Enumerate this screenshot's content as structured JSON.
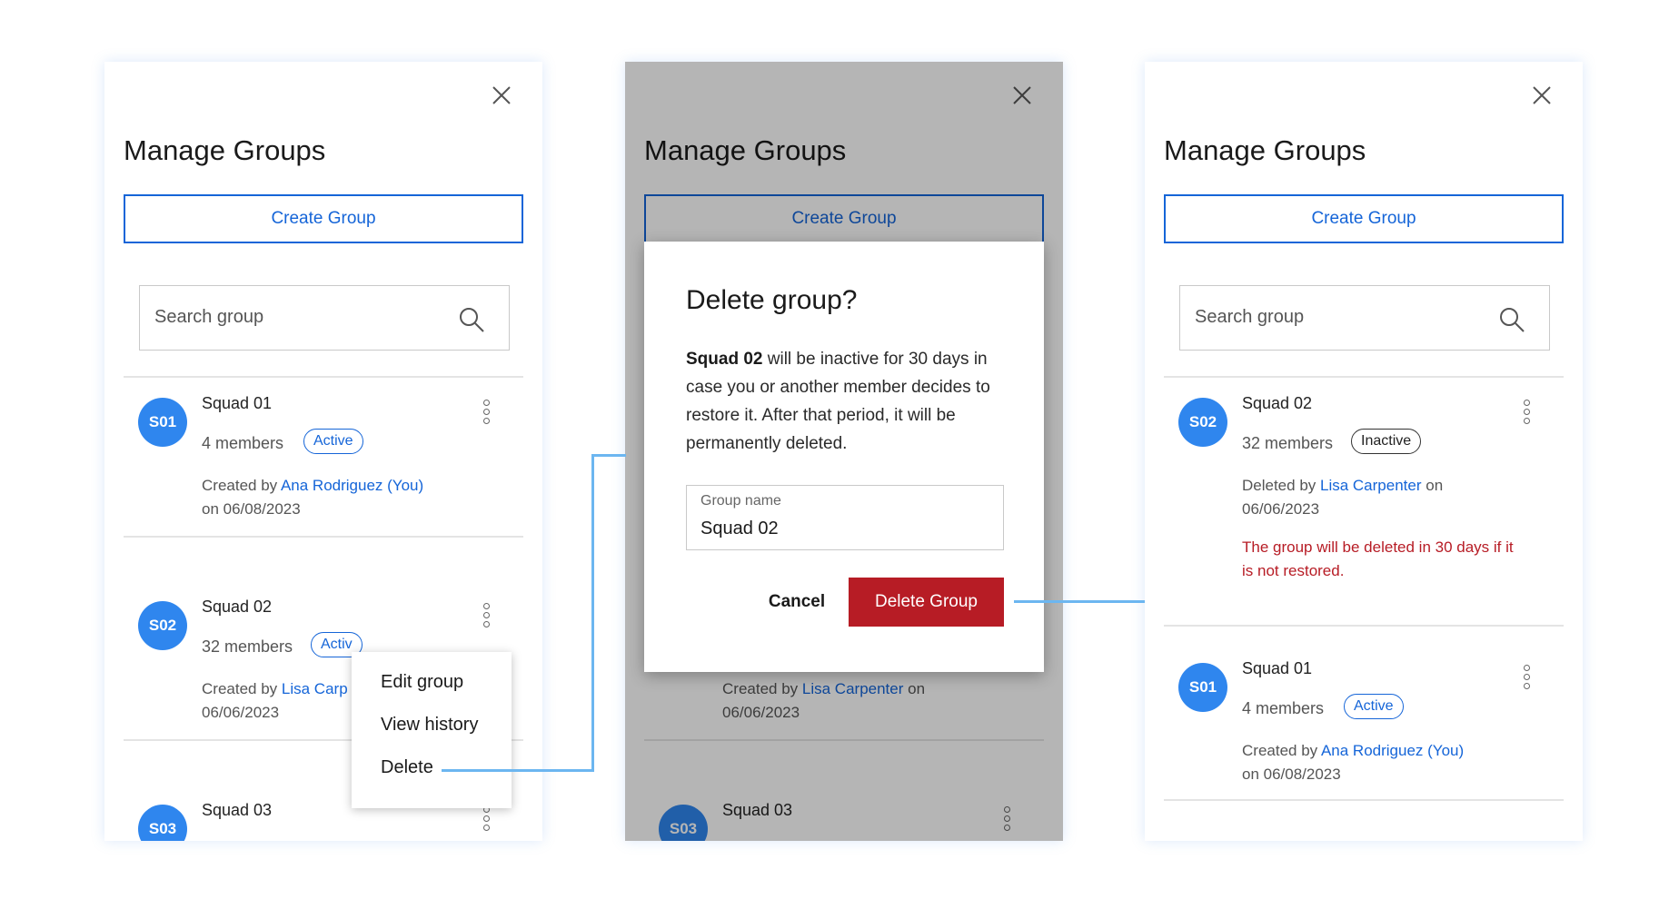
{
  "panel_left": {
    "title": "Manage Groups",
    "create_label": "Create Group",
    "search_placeholder": "Search group",
    "groups": [
      {
        "initials": "S01",
        "name": "Squad 01",
        "members": "4 members",
        "status": "Active",
        "meta_prefix": "Created by ",
        "meta_user": "Ana Rodriguez (You)",
        "meta_suffix": "",
        "meta_date": "on 06/08/2023"
      },
      {
        "initials": "S02",
        "name": "Squad 02",
        "members": "32 members",
        "status": "Activ",
        "meta_prefix": "Created by ",
        "meta_user": "Lisa Carp",
        "meta_date": "06/06/2023"
      },
      {
        "initials": "S03",
        "name": "Squad 03"
      }
    ],
    "context_menu": [
      "Edit group",
      "View history",
      "Delete"
    ]
  },
  "panel_middle": {
    "title": "Manage Groups",
    "create_label": "Create Group",
    "dialog": {
      "title": "Delete group?",
      "body_bold": "Squad 02",
      "body_text": " will be inactive for 30 days in case you or another member decides to restore it. After that period, it will be permanently deleted.",
      "field_label": "Group name",
      "field_value": "Squad 02",
      "cancel_label": "Cancel",
      "delete_label": "Delete Group"
    },
    "behind": {
      "meta_prefix": "Created by ",
      "meta_user": "Lisa Carpenter",
      "meta_suffix": " on",
      "meta_date": "06/06/2023",
      "s03_initials": "S03",
      "s03_name": "Squad 03"
    }
  },
  "panel_right": {
    "title": "Manage Groups",
    "create_label": "Create Group",
    "search_placeholder": "Search group",
    "groups": [
      {
        "initials": "S02",
        "name": "Squad 02",
        "members": "32 members",
        "status": "Inactive",
        "meta_prefix": "Deleted by ",
        "meta_user": "Lisa Carpenter",
        "meta_suffix": " on",
        "meta_date": "06/06/2023",
        "warning": "The group will be deleted in 30 days if it is not restored."
      },
      {
        "initials": "S01",
        "name": "Squad 01",
        "members": "4 members",
        "status": "Active",
        "meta_prefix": "Created by ",
        "meta_user": "Ana Rodriguez (You)",
        "meta_date": "on 06/08/2023"
      }
    ]
  },
  "colors": {
    "primary": "#1565d8",
    "avatar": "#2f86ee",
    "danger": "#b71c25",
    "connector": "#6cb6f0"
  },
  "icons": [
    "close-icon",
    "search-icon",
    "more-vertical-icon"
  ]
}
